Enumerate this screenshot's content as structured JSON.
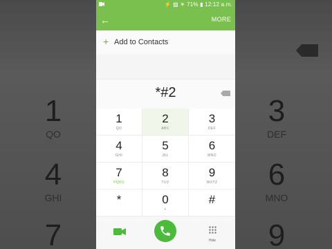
{
  "status_bar": {
    "icons_text": "⚡ ▨ ☀ 71% ▮",
    "time": "12:12 a.m."
  },
  "app_bar": {
    "more_label": "MORE"
  },
  "add_contacts": {
    "label": "Add to Contacts"
  },
  "dial_input": {
    "value": "*#2"
  },
  "keypad": [
    {
      "digit": "1",
      "letters": "QO"
    },
    {
      "digit": "2",
      "letters": "ABC"
    },
    {
      "digit": "3",
      "letters": "DEF"
    },
    {
      "digit": "4",
      "letters": "GHI"
    },
    {
      "digit": "5",
      "letters": "JKL"
    },
    {
      "digit": "6",
      "letters": "MNO"
    },
    {
      "digit": "7",
      "letters": "PQRS"
    },
    {
      "digit": "8",
      "letters": "TUV"
    },
    {
      "digit": "9",
      "letters": "WXYZ"
    },
    {
      "digit": "*",
      "letters": ""
    },
    {
      "digit": "0",
      "letters": "+"
    },
    {
      "digit": "#",
      "letters": ""
    }
  ],
  "bottom_bar": {
    "hide_label": "Hide"
  },
  "background": {
    "digits": [
      "1",
      "3",
      "4",
      "6",
      "7",
      "9"
    ],
    "letters": [
      "QO",
      "DEF",
      "GHI",
      "MNO"
    ]
  },
  "colors": {
    "accent": "#7ac04e",
    "call": "#4cbb3c"
  }
}
